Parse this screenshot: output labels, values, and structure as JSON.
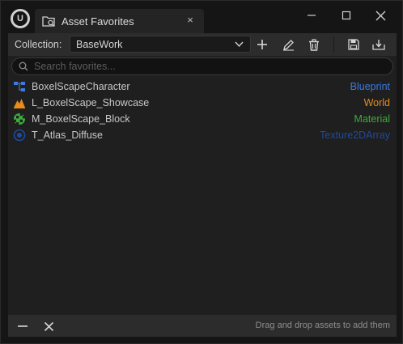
{
  "window": {
    "tab_title": "Asset Favorites",
    "tab_close": "×"
  },
  "toolbar": {
    "collection_label": "Collection:",
    "collection_value": "BaseWork"
  },
  "search": {
    "placeholder": "Search favorites..."
  },
  "assets": [
    {
      "name": "BoxelScapeCharacter",
      "type": "Blueprint",
      "icon": "blueprint-icon",
      "type_color": "#3d79e0"
    },
    {
      "name": "L_BoxelScape_Showcase",
      "type": "World",
      "icon": "world-icon",
      "type_color": "#e88a1c"
    },
    {
      "name": "M_BoxelScape_Block",
      "type": "Material",
      "icon": "material-icon",
      "type_color": "#3dab3d"
    },
    {
      "name": "T_Atlas_Diffuse",
      "type": "Texture2DArray",
      "icon": "texture-icon",
      "type_color": "#1f4aa0"
    }
  ],
  "footer": {
    "hint": "Drag and drop assets to add them"
  },
  "colors": {
    "window_bg": "#151515",
    "panel_bg": "#1f1f1f",
    "toolbar_bg": "#2c2c2c"
  }
}
